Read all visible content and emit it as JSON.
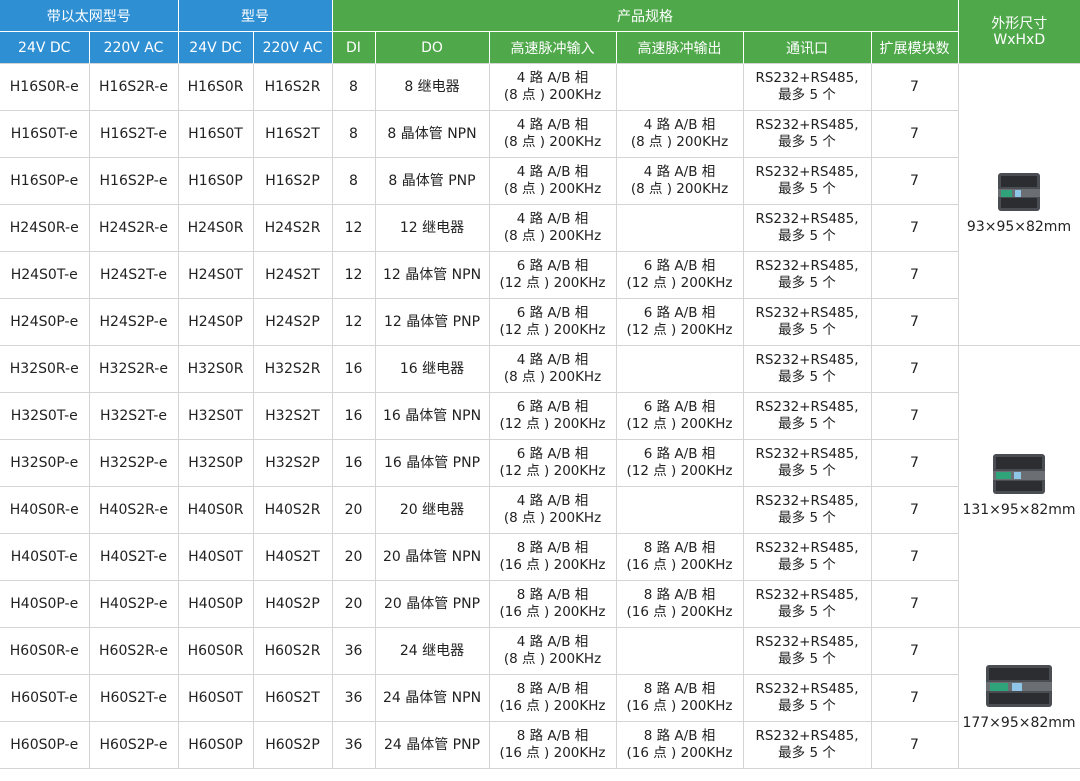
{
  "header": {
    "group_ethernet": "带以太网型号",
    "group_model": "型号",
    "group_spec": "产品规格",
    "group_dims": "外形尺寸",
    "dims_sub": "WxHxD",
    "sub_24vdc": "24V DC",
    "sub_220vac": "220V AC",
    "sub_24vdc_2": "24V DC",
    "sub_220vac_2": "220V AC",
    "di": "DI",
    "do": "DO",
    "hs_in": "高速脉冲输入",
    "hs_out": "高速脉冲输出",
    "comm": "通讯口",
    "ext": "扩展模块数"
  },
  "colors": {
    "blue": "#2f8fd3",
    "green": "#4fa84a",
    "border": "#d4d4d4"
  },
  "rows": [
    {
      "eth24": "H16S0R-e",
      "eth220": "H16S2R-e",
      "m24": "H16S0R",
      "m220": "H16S2R",
      "di": "8",
      "do": "8 继电器",
      "in1": "4 路 A/B 相",
      "in2": "(8 点 ) 200KHz",
      "out1": "",
      "out2": "",
      "c1": "RS232+RS485,",
      "c2": "最多 5 个",
      "ext": "7"
    },
    {
      "eth24": "H16S0T-e",
      "eth220": "H16S2T-e",
      "m24": "H16S0T",
      "m220": "H16S2T",
      "di": "8",
      "do": "8 晶体管 NPN",
      "in1": "4 路 A/B 相",
      "in2": "(8 点 ) 200KHz",
      "out1": "4 路 A/B 相",
      "out2": "(8 点 ) 200KHz",
      "c1": "RS232+RS485,",
      "c2": "最多 5 个",
      "ext": "7"
    },
    {
      "eth24": "H16S0P-e",
      "eth220": "H16S2P-e",
      "m24": "H16S0P",
      "m220": "H16S2P",
      "di": "8",
      "do": "8 晶体管 PNP",
      "in1": "4 路 A/B 相",
      "in2": "(8 点 ) 200KHz",
      "out1": "4 路 A/B 相",
      "out2": "(8 点 ) 200KHz",
      "c1": "RS232+RS485,",
      "c2": "最多 5 个",
      "ext": "7"
    },
    {
      "eth24": "H24S0R-e",
      "eth220": "H24S2R-e",
      "m24": "H24S0R",
      "m220": "H24S2R",
      "di": "12",
      "do": "12 继电器",
      "in1": "4 路 A/B 相",
      "in2": "(8 点 ) 200KHz",
      "out1": "",
      "out2": "",
      "c1": "RS232+RS485,",
      "c2": "最多 5 个",
      "ext": "7"
    },
    {
      "eth24": "H24S0T-e",
      "eth220": "H24S2T-e",
      "m24": "H24S0T",
      "m220": "H24S2T",
      "di": "12",
      "do": "12 晶体管 NPN",
      "in1": "6 路 A/B 相",
      "in2": "(12 点 ) 200KHz",
      "out1": "6 路 A/B 相",
      "out2": "(12 点 ) 200KHz",
      "c1": "RS232+RS485,",
      "c2": "最多 5 个",
      "ext": "7"
    },
    {
      "eth24": "H24S0P-e",
      "eth220": "H24S2P-e",
      "m24": "H24S0P",
      "m220": "H24S2P",
      "di": "12",
      "do": "12 晶体管 PNP",
      "in1": "6 路 A/B 相",
      "in2": "(12 点 ) 200KHz",
      "out1": "6 路 A/B 相",
      "out2": "(12 点 ) 200KHz",
      "c1": "RS232+RS485,",
      "c2": "最多 5 个",
      "ext": "7"
    },
    {
      "eth24": "H32S0R-e",
      "eth220": "H32S2R-e",
      "m24": "H32S0R",
      "m220": "H32S2R",
      "di": "16",
      "do": "16 继电器",
      "in1": "4 路 A/B 相",
      "in2": "(8 点 ) 200KHz",
      "out1": "",
      "out2": "",
      "c1": "RS232+RS485,",
      "c2": "最多 5 个",
      "ext": "7"
    },
    {
      "eth24": "H32S0T-e",
      "eth220": "H32S2T-e",
      "m24": "H32S0T",
      "m220": "H32S2T",
      "di": "16",
      "do": "16 晶体管 NPN",
      "in1": "6 路 A/B 相",
      "in2": "(12 点 ) 200KHz",
      "out1": "6 路 A/B 相",
      "out2": "(12 点 ) 200KHz",
      "c1": "RS232+RS485,",
      "c2": "最多 5 个",
      "ext": "7"
    },
    {
      "eth24": "H32S0P-e",
      "eth220": "H32S2P-e",
      "m24": "H32S0P",
      "m220": "H32S2P",
      "di": "16",
      "do": "16 晶体管 PNP",
      "in1": "6 路 A/B 相",
      "in2": "(12 点 ) 200KHz",
      "out1": "6 路 A/B 相",
      "out2": "(12 点 ) 200KHz",
      "c1": "RS232+RS485,",
      "c2": "最多 5 个",
      "ext": "7"
    },
    {
      "eth24": "H40S0R-e",
      "eth220": "H40S2R-e",
      "m24": "H40S0R",
      "m220": "H40S2R",
      "di": "20",
      "do": "20 继电器",
      "in1": "4 路 A/B 相",
      "in2": "(8 点 ) 200KHz",
      "out1": "",
      "out2": "",
      "c1": "RS232+RS485,",
      "c2": "最多 5 个",
      "ext": "7"
    },
    {
      "eth24": "H40S0T-e",
      "eth220": "H40S2T-e",
      "m24": "H40S0T",
      "m220": "H40S2T",
      "di": "20",
      "do": "20 晶体管 NPN",
      "in1": "8 路 A/B 相",
      "in2": "(16 点 ) 200KHz",
      "out1": "8 路 A/B 相",
      "out2": "(16 点 ) 200KHz",
      "c1": "RS232+RS485,",
      "c2": "最多 5 个",
      "ext": "7"
    },
    {
      "eth24": "H40S0P-e",
      "eth220": "H40S2P-e",
      "m24": "H40S0P",
      "m220": "H40S2P",
      "di": "20",
      "do": "20 晶体管 PNP",
      "in1": "8 路 A/B 相",
      "in2": "(16 点 ) 200KHz",
      "out1": "8 路 A/B 相",
      "out2": "(16 点 ) 200KHz",
      "c1": "RS232+RS485,",
      "c2": "最多 5 个",
      "ext": "7"
    },
    {
      "eth24": "H60S0R-e",
      "eth220": "H60S2R-e",
      "m24": "H60S0R",
      "m220": "H60S2R",
      "di": "36",
      "do": "24 继电器",
      "in1": "4 路 A/B 相",
      "in2": "(8 点 ) 200KHz",
      "out1": "",
      "out2": "",
      "c1": "RS232+RS485,",
      "c2": "最多 5 个",
      "ext": "7"
    },
    {
      "eth24": "H60S0T-e",
      "eth220": "H60S2T-e",
      "m24": "H60S0T",
      "m220": "H60S2T",
      "di": "36",
      "do": "24 晶体管 NPN",
      "in1": "8 路 A/B 相",
      "in2": "(16 点 ) 200KHz",
      "out1": "8 路 A/B 相",
      "out2": "(16 点 ) 200KHz",
      "c1": "RS232+RS485,",
      "c2": "最多 5 个",
      "ext": "7"
    },
    {
      "eth24": "H60S0P-e",
      "eth220": "H60S2P-e",
      "m24": "H60S0P",
      "m220": "H60S2P",
      "di": "36",
      "do": "24 晶体管 PNP",
      "in1": "8 路 A/B 相",
      "in2": "(16 点 ) 200KHz",
      "out1": "8 路 A/B 相",
      "out2": "(16 点 ) 200KHz",
      "c1": "RS232+RS485,",
      "c2": "最多 5 个",
      "ext": "7"
    }
  ],
  "dims": [
    {
      "size": "93×95×82mm",
      "image": "plc-small-product-image"
    },
    {
      "size": "131×95×82mm",
      "image": "plc-medium-product-image"
    },
    {
      "size": "177×95×82mm",
      "image": "plc-large-product-image"
    }
  ]
}
